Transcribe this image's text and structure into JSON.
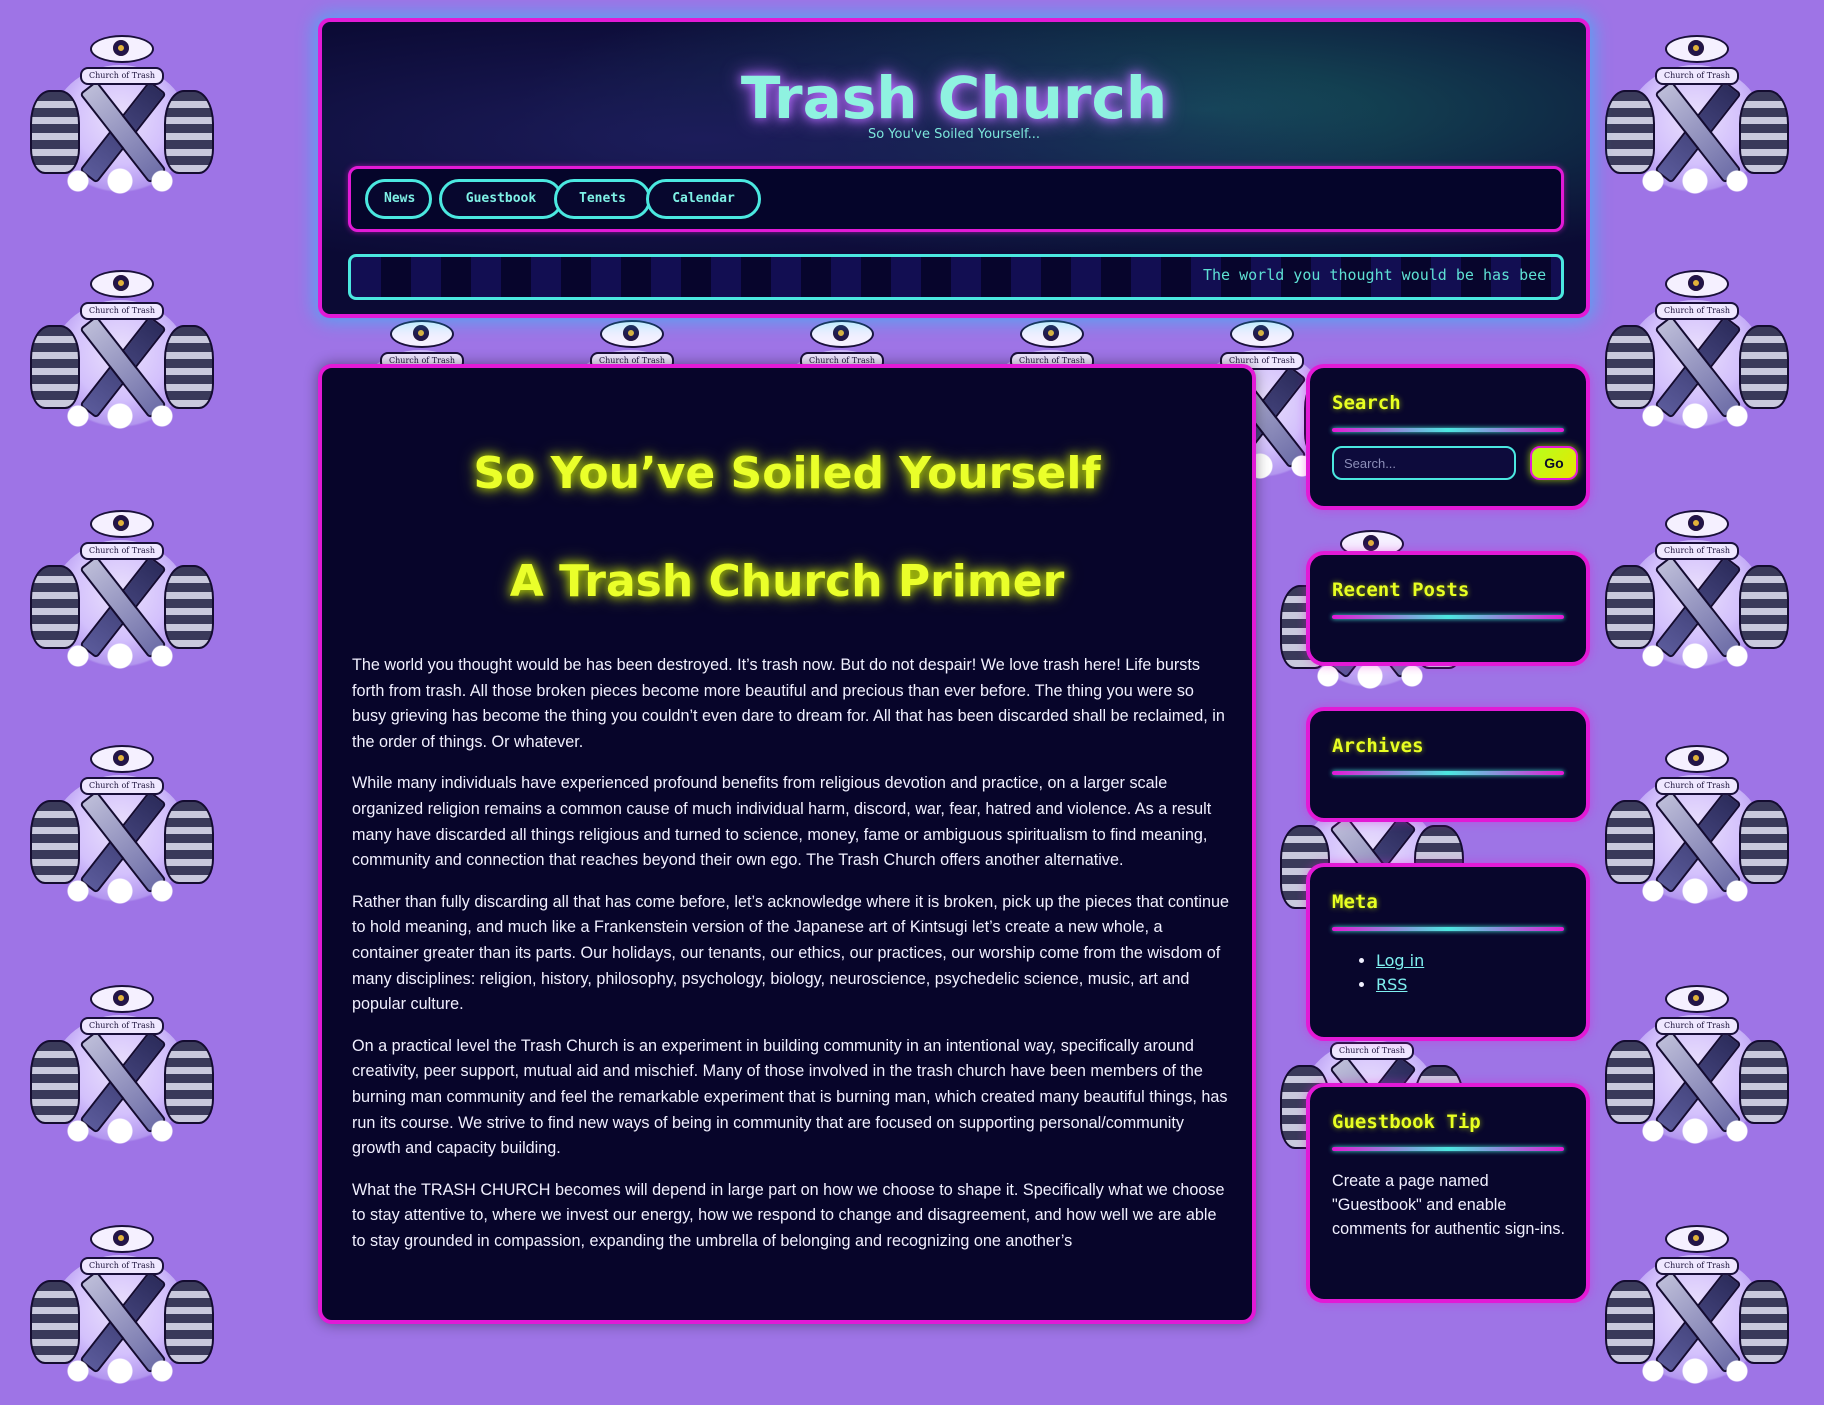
{
  "colors": {
    "background": "#9e74e6",
    "frame_border": "#e21ad6",
    "accent_cyan": "#4be8e0",
    "title_yellow": "#eaff2a",
    "panel_dark": "#07052a"
  },
  "emblem": {
    "banner_text": "Church of Trash"
  },
  "header": {
    "site_title": "Trash Church",
    "tagline": "So You've Soiled Yourself...",
    "nav": [
      {
        "label": "News"
      },
      {
        "label": "Guestbook"
      },
      {
        "label": "Tenets"
      },
      {
        "label": "Calendar"
      }
    ],
    "ticker": "The world you thought would be has bee"
  },
  "main": {
    "title_line1": "So You’ve Soiled Yourself",
    "title_line2": "A Trash Church Primer",
    "paragraphs": [
      "The world you thought would be has been destroyed. It’s trash now. But do not despair! We love trash here! Life bursts forth from trash. All those broken pieces become more beautiful and precious than ever before. The thing you were so busy grieving has become the thing you couldn’t even dare to dream for. All that has been discarded shall be reclaimed, in the order of things. Or whatever.",
      "While many individuals have experienced profound benefits from religious devotion and practice, on a larger scale organized religion remains a common cause of much individual harm, discord, war, fear, hatred and violence. As a result many have discarded all things religious and turned to science, money, fame or ambiguous spiritualism to find meaning, community and connection that reaches beyond their own ego. The Trash Church offers another alternative.",
      "Rather than fully discarding all that has come before, let’s acknowledge where it is broken, pick up the pieces that continue to hold meaning, and much like a Frankenstein version of the Japanese art of Kintsugi let’s create a new whole, a container greater than its parts. Our holidays, our tenants, our ethics, our practices, our worship come from the wisdom of many disciplines: religion, history, philosophy, psychology, biology, neuroscience, psychedelic science, music, art and popular culture.",
      "On a practical level the Trash Church is an experiment in building community in an intentional way, specifically around creativity, peer support, mutual aid and mischief. Many of those involved in the trash church have been members of the burning man community and feel the remarkable experiment that is burning man, which created many beautiful things, has run its course. We strive to find new ways of being in community that are focused on supporting personal/community growth and capacity building.",
      "What the TRASH CHURCH becomes will depend in large part on how we choose to shape it. Specifically what we choose to stay attentive to, where we invest our energy, how we respond to change and disagreement, and how well we are able to stay grounded in compassion, expanding the umbrella of belonging and recognizing one another’s"
    ]
  },
  "sidebar": {
    "search": {
      "title": "Search",
      "placeholder": "Search...",
      "button_label": "Go"
    },
    "recent_posts": {
      "title": "Recent Posts"
    },
    "archives": {
      "title": "Archives"
    },
    "meta": {
      "title": "Meta",
      "links": [
        {
          "label": "Log in"
        },
        {
          "label": "RSS"
        }
      ]
    },
    "guestbook_tip": {
      "title": "Guestbook Tip",
      "text": "Create a page named \"Guestbook\" and enable comments for authentic sign-ins."
    }
  }
}
